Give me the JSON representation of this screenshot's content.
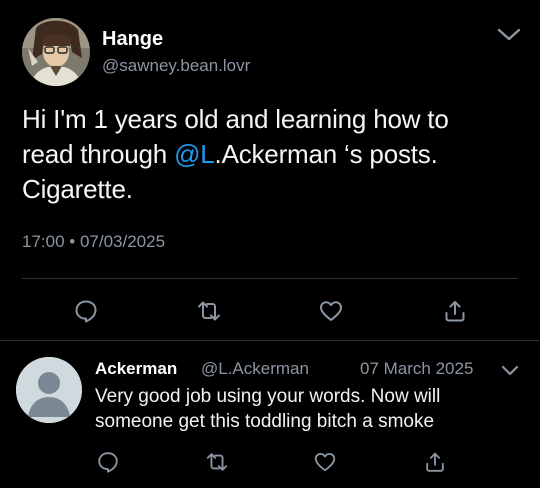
{
  "tweet": {
    "author_name": "Hange",
    "author_handle": "@sawney.bean.lovr",
    "text_line1": "Hi I'm 1 years old and learning how to",
    "text_line2_pre": "read through ",
    "text_line2_mention": "@L",
    "text_line2_post": ".Ackerman ‘s posts.",
    "text_line3": "Cigarette.",
    "timestamp": "17:00 • 07/03/2025",
    "icons": [
      "reply-icon",
      "retweet-icon",
      "like-icon",
      "share-icon",
      "chevron-down-icon"
    ]
  },
  "reply": {
    "author_name": "Ackerman",
    "author_handle": "@L.Ackerman",
    "date": "07 March 2025",
    "text_line1": "Very good job using your words. Now will",
    "text_line2": "someone get this toddling bitch a smoke",
    "icons": [
      "reply-icon",
      "retweet-icon",
      "like-icon",
      "share-icon",
      "chevron-down-icon"
    ]
  },
  "colors": {
    "background": "#000000",
    "mention": "#1d9bf0",
    "secondary_text": "#8b96a2",
    "divider": "#2f3336",
    "icon": "#8b96a2"
  }
}
